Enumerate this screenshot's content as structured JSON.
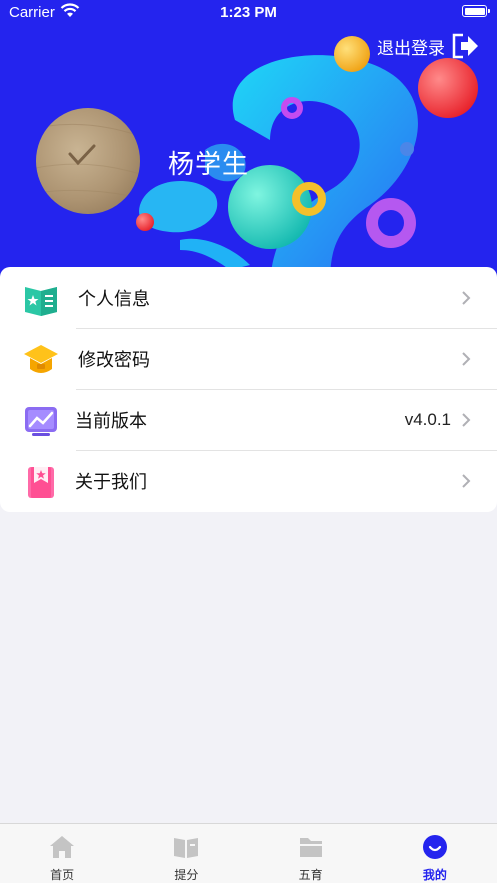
{
  "status_bar": {
    "carrier": "Carrier",
    "time": "1:23 PM"
  },
  "header": {
    "logout_label": "退出登录",
    "user_name": "杨学生"
  },
  "menu": {
    "items": [
      {
        "label": "个人信息",
        "value": ""
      },
      {
        "label": "修改密码",
        "value": ""
      },
      {
        "label": "当前版本",
        "value": "v4.0.1"
      },
      {
        "label": "关于我们",
        "value": ""
      }
    ]
  },
  "tabbar": {
    "tabs": [
      {
        "label": "首页",
        "icon": "home-icon",
        "active": false
      },
      {
        "label": "提分",
        "icon": "book-icon",
        "active": false
      },
      {
        "label": "五育",
        "icon": "folder-icon",
        "active": false
      },
      {
        "label": "我的",
        "icon": "smile-icon",
        "active": true
      }
    ]
  },
  "colors": {
    "brand": "#2424ee",
    "background": "#f2f2f7",
    "inactive_tab": "#c4c4c4"
  }
}
